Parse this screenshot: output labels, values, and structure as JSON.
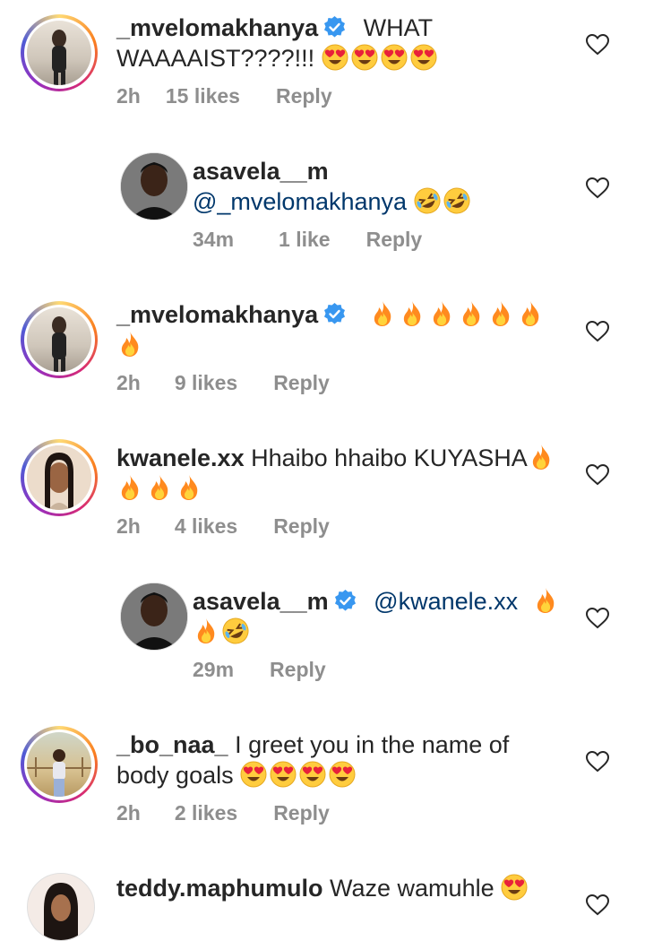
{
  "comments": [
    {
      "username": "_mvelomakhanya",
      "verified": true,
      "text": "WHAT WAAAAIST????!!!",
      "emoji": [
        "heart-eyes",
        "heart-eyes",
        "heart-eyes",
        "heart-eyes"
      ],
      "time": "2h",
      "likes": "15 likes",
      "reply": "Reply",
      "reply_thread": false
    },
    {
      "username": "asavela__m",
      "verified": false,
      "mention": "@_mvelomakhanya",
      "emoji": [
        "rofl",
        "rofl"
      ],
      "time": "34m",
      "likes": "1 like",
      "reply": "Reply",
      "reply_thread": true
    },
    {
      "username": "_mvelomakhanya",
      "verified": true,
      "emoji": [
        "fire",
        "fire",
        "fire",
        "fire",
        "fire",
        "fire",
        "fire"
      ],
      "time": "2h",
      "likes": "9 likes",
      "reply": "Reply",
      "reply_thread": false
    },
    {
      "username": "kwanele.xx",
      "verified": false,
      "text": "Hhaibo hhaibo KUYASHA",
      "emoji": [
        "fire",
        "fire",
        "fire",
        "fire"
      ],
      "time": "2h",
      "likes": "4 likes",
      "reply": "Reply",
      "reply_thread": false
    },
    {
      "username": "asavela__m",
      "verified": true,
      "mention": "@kwanele.xx",
      "emoji": [
        "fire",
        "fire",
        "rofl"
      ],
      "time": "29m",
      "likes": "",
      "reply": "Reply",
      "reply_thread": true
    },
    {
      "username": "_bo_naa_",
      "verified": false,
      "text": "I greet you in the name of body goals",
      "emoji": [
        "heart-eyes",
        "heart-eyes",
        "heart-eyes",
        "heart-eyes"
      ],
      "time": "2h",
      "likes": "2 likes",
      "reply": "Reply",
      "reply_thread": false
    },
    {
      "username": "teddy.maphumulo",
      "verified": false,
      "text": "Waze wamuhle",
      "emoji": [
        "heart-eyes"
      ],
      "reply_thread": false
    }
  ],
  "colors": {
    "verified_blue": "#3897f0",
    "meta_gray": "#8e8e8e",
    "mention_blue": "#00376b"
  }
}
